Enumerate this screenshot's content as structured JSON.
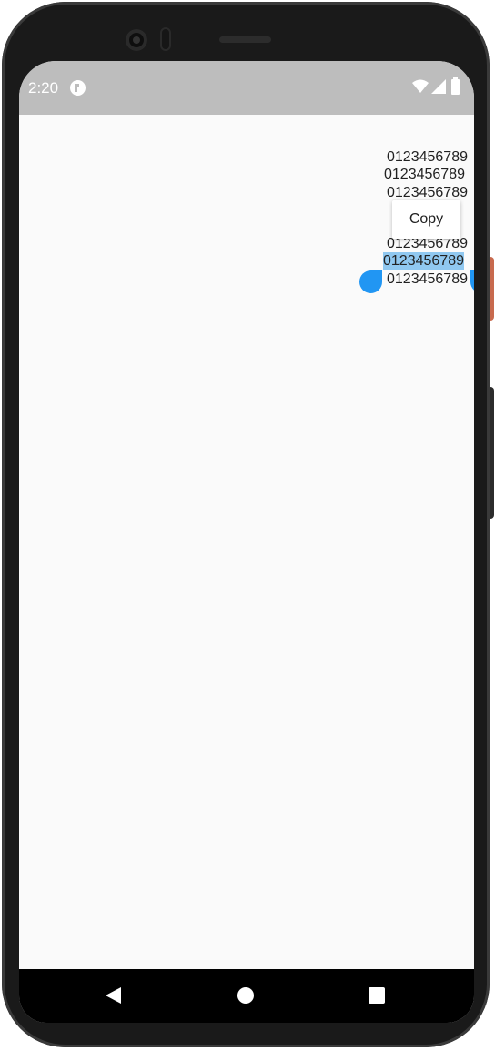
{
  "status_bar": {
    "time": "2:20",
    "app_icon": "app-notification-icon",
    "icons": [
      "wifi-icon",
      "signal-icon",
      "battery-icon"
    ],
    "background_color": "#bdbdbd"
  },
  "content": {
    "lines": [
      "0123456789",
      "0123456789",
      "0123456789",
      "0123456789",
      "0123456789",
      "0123456789"
    ],
    "selected_line_index": 4,
    "selection_color": "#90c8f0",
    "handle_color": "#2196f3"
  },
  "popup": {
    "copy_label": "Copy"
  },
  "nav_bar": {
    "icons": [
      "back-icon",
      "home-icon",
      "recents-icon"
    ]
  }
}
